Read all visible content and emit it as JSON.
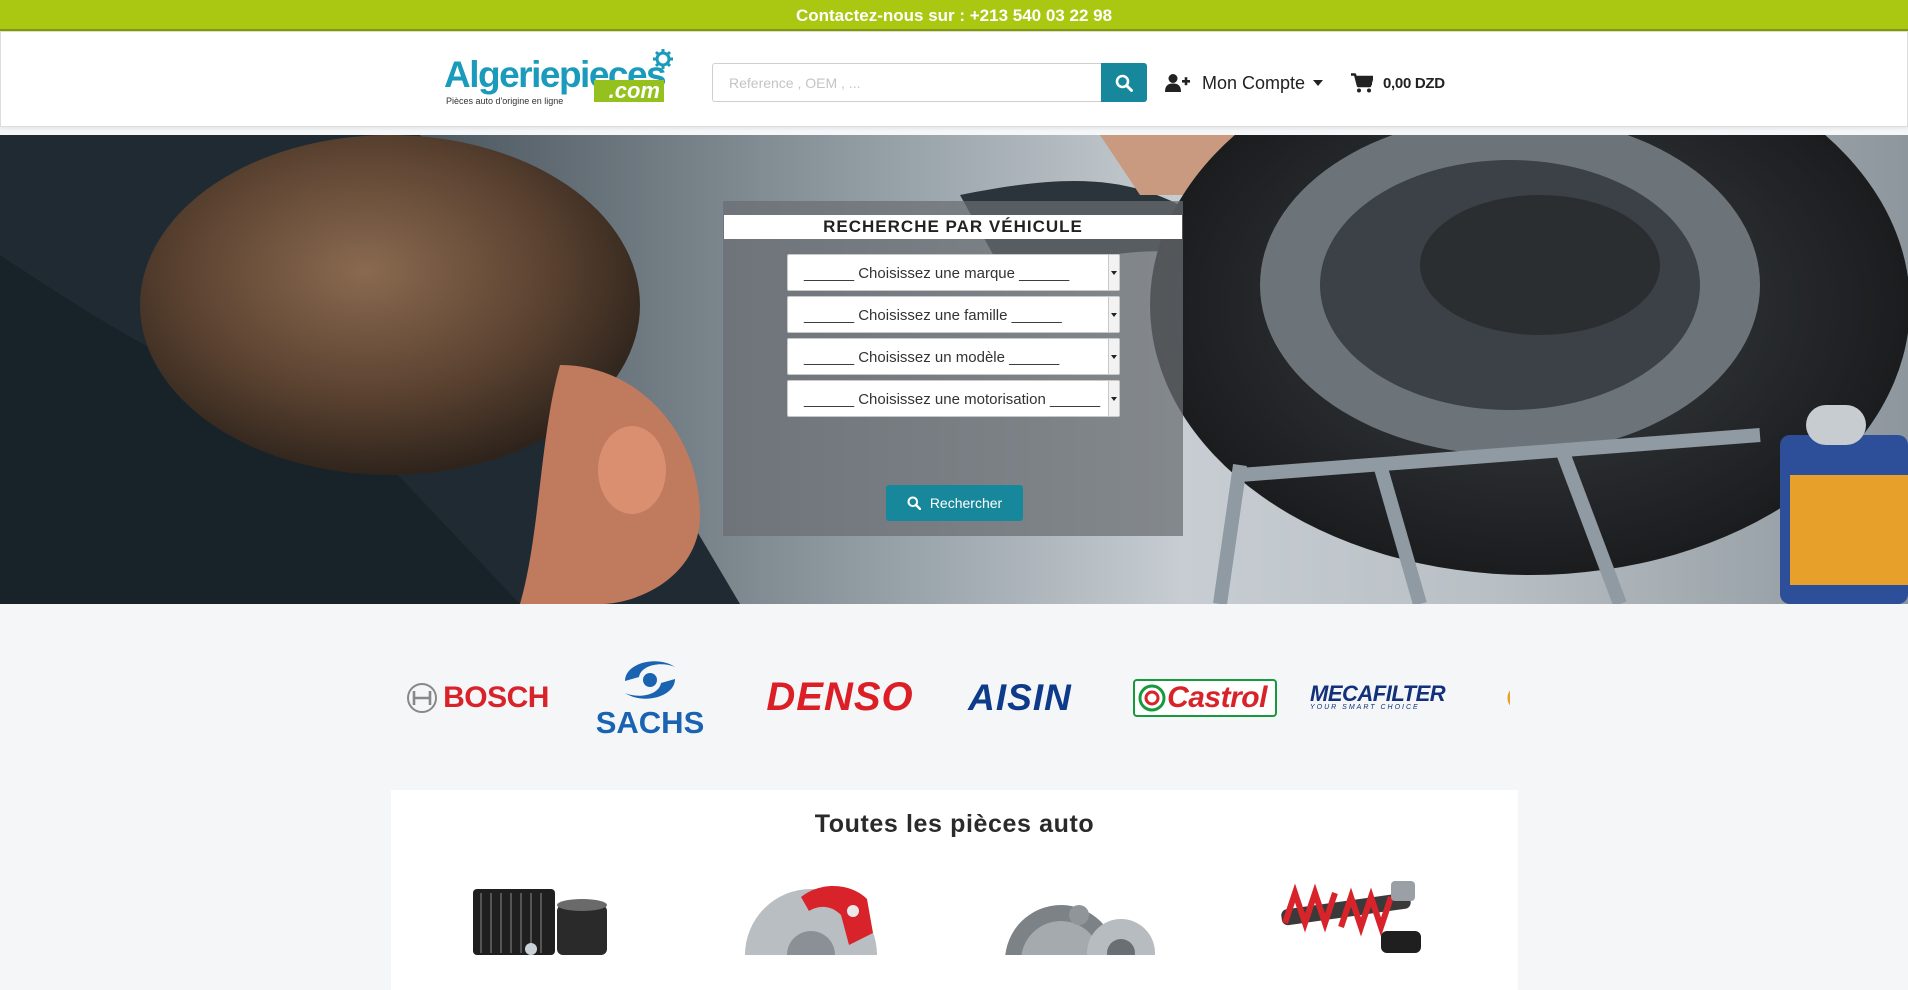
{
  "topbar": {
    "contact": "Contactez-nous sur : +213 540 03 22 98"
  },
  "header": {
    "logo": {
      "name_part1": "Algerie",
      "name_part2": "pieces",
      "suffix": ".com",
      "tagline": "Pièces auto d'origine en ligne"
    },
    "search": {
      "placeholder": "Reference , OEM , ..."
    },
    "account": {
      "label": "Mon Compte"
    },
    "cart": {
      "total": "0,00 DZD"
    }
  },
  "vehicle_search": {
    "title": "RECHERCHE PAR VÉHICULE",
    "selects": [
      "______ Choisissez une marque ______",
      "______ Choisissez une famille ______",
      "______ Choisissez un modèle ______",
      "______ Choisissez une motorisation ______"
    ],
    "button": "Rechercher"
  },
  "brands": [
    {
      "name": "BOSCH",
      "color": "#d8232a"
    },
    {
      "name": "SACHS",
      "color": "#1a63b3"
    },
    {
      "name": "DENSO",
      "color": "#dc1f26"
    },
    {
      "name": "AISIN",
      "color": "#0e3a8a"
    },
    {
      "name": "Castrol",
      "color": "#d8232a"
    },
    {
      "name": "MECAFILTER",
      "tagline": "YOUR SMART CHOICE",
      "color": "#13317a"
    }
  ],
  "products": {
    "title": "Toutes les pièces auto"
  },
  "colors": {
    "accent": "#17879b",
    "topbar": "#aac812",
    "logo_blue": "#1a9bbb",
    "logo_green": "#95c11f"
  }
}
